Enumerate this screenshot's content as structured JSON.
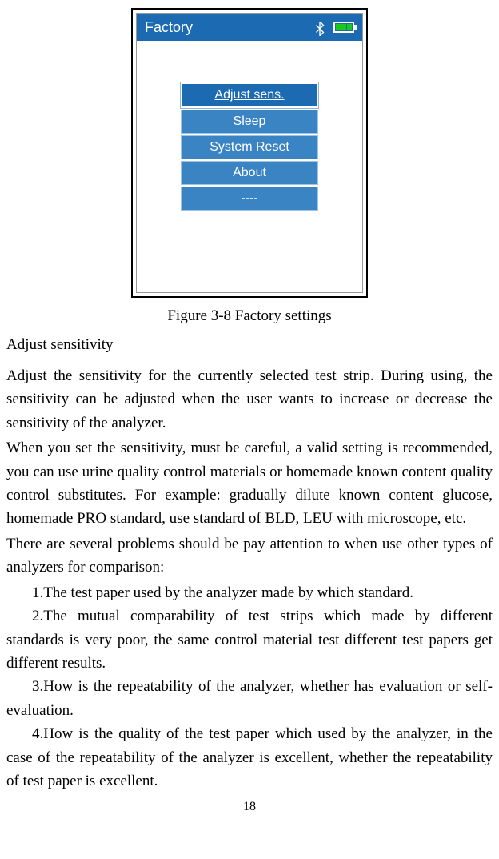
{
  "device": {
    "title": "Factory",
    "menu": {
      "item1": "Adjust sens.",
      "item2": "Sleep",
      "item3": "System Reset",
      "item4": "About",
      "item5": "----"
    }
  },
  "figure": {
    "caption": "Figure 3-8 Factory settings"
  },
  "section": {
    "title": "Adjust sensitivity",
    "para1": "Adjust the sensitivity for the currently selected test strip. During using, the sensitivity can be adjusted when the user wants to increase or decrease the sensitivity of the analyzer.",
    "para2": "When you set the sensitivity, must be careful, a valid setting is recommended, you can use urine quality control materials or homemade known content quality control substitutes. For example: gradually dilute known content glucose, homemade PRO standard, use standard of BLD, LEU with microscope, etc.",
    "para3": "There are several problems should be pay attention to when use other types of analyzers for comparison:",
    "list1": "1.The test paper used by the analyzer made by which standard.",
    "list2": "2.The mutual comparability of test strips which made by different standards is very poor, the same control material test different test papers get different results.",
    "list3": "3.How is the repeatability of the analyzer, whether has evaluation or self-evaluation.",
    "list4": "4.How is the quality of the test paper which used by the analyzer, in the case of the repeatability of the analyzer is excellent, whether the repeatability of test paper is excellent."
  },
  "page_number": "18"
}
